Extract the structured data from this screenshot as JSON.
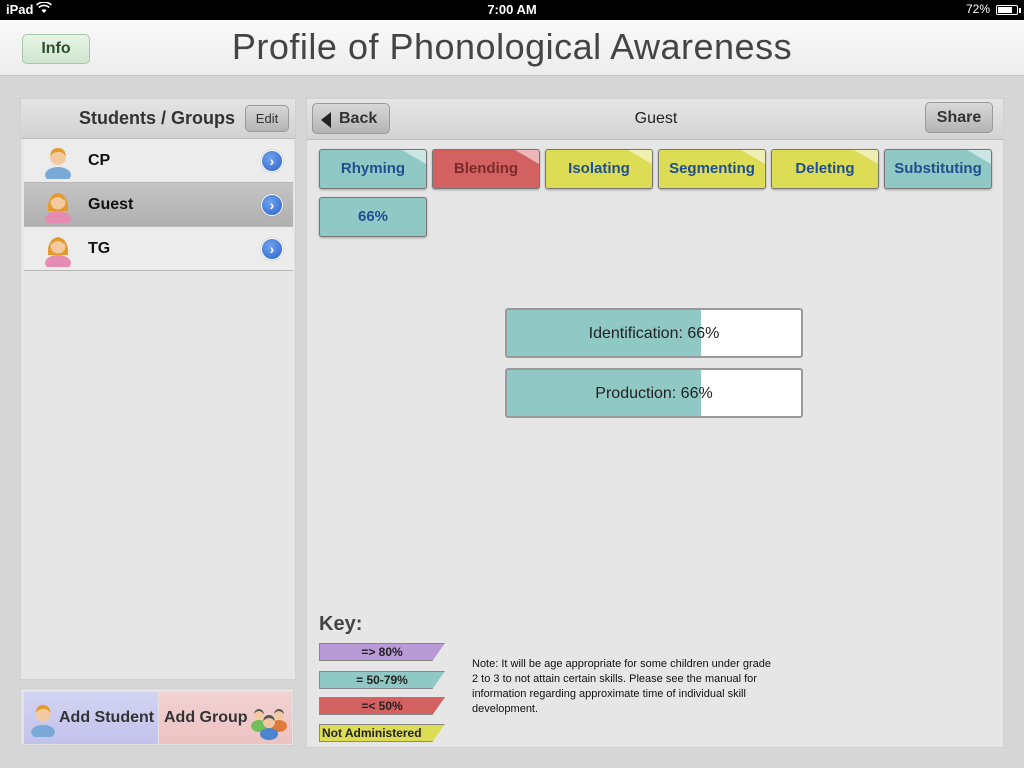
{
  "status_bar": {
    "device": "iPad",
    "time": "7:00 AM",
    "battery": "72%"
  },
  "header": {
    "info_label": "Info",
    "title": "Profile of Phonological Awareness"
  },
  "sidebar": {
    "title": "Students / Groups",
    "edit_label": "Edit",
    "students": [
      {
        "name": "CP",
        "selected": false
      },
      {
        "name": "Guest",
        "selected": true
      },
      {
        "name": "TG",
        "selected": false
      }
    ],
    "add_student_label": "Add Student",
    "add_group_label": "Add Group"
  },
  "detail": {
    "back_label": "Back",
    "title": "Guest",
    "share_label": "Share",
    "tabs": [
      {
        "label": "Rhyming",
        "color": "#8fc8c4"
      },
      {
        "label": "Blending",
        "color": "#d36161"
      },
      {
        "label": "Isolating",
        "color": "#dcdc55"
      },
      {
        "label": "Segmenting",
        "color": "#dcdc55"
      },
      {
        "label": "Deleting",
        "color": "#dcdc55"
      },
      {
        "label": "Substituting",
        "color": "#8fc8c4"
      }
    ],
    "score": "66%",
    "bars": [
      {
        "label": "Identification: 66%",
        "percent": 66
      },
      {
        "label": "Production: 66%",
        "percent": 66
      }
    ]
  },
  "key": {
    "title": "Key:",
    "items": [
      {
        "label": "=> 80%",
        "color": "#b89ad6"
      },
      {
        "label": "= 50-79%",
        "color": "#8fc8c4"
      },
      {
        "label": "=< 50%",
        "color": "#d36161"
      },
      {
        "label": "Not Administered",
        "color": "#dcdc55"
      }
    ],
    "note": "Note: It will be age appropriate for some children under grade 2 to 3 to not attain certain skills. Please see the manual for information regarding approximate time of individual skill development."
  }
}
